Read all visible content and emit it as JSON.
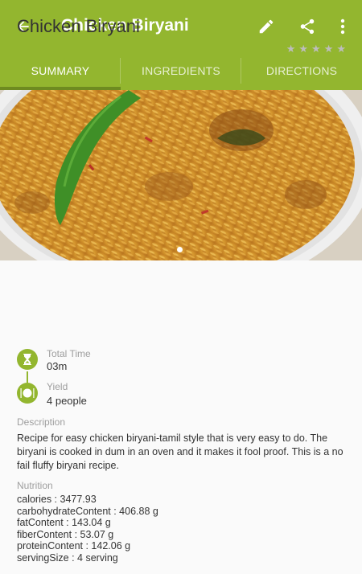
{
  "toolbar": {
    "title": "Chicken Biryani",
    "back_icon": "arrow-back-icon",
    "edit_icon": "pencil-icon",
    "share_icon": "share-icon",
    "more_icon": "more-vert-icon"
  },
  "tabs": [
    {
      "label": "SUMMARY",
      "active": true
    },
    {
      "label": "INGREDIENTS",
      "active": false
    },
    {
      "label": "DIRECTIONS",
      "active": false
    }
  ],
  "recipe": {
    "name": "Chicken Biryani",
    "rating_stars": 5,
    "rating_value": 0,
    "total_time_label": "Total Time",
    "total_time_value": "03m",
    "yield_label": "Yield",
    "yield_value": "4 people",
    "description_label": "Description",
    "description": "Recipe for easy chicken biryani-tamil style that is very easy to do. The biryani is cooked in dum in an oven and it makes it fool proof. This is a no fail fluffy biryani recipe.",
    "nutrition_label": "Nutrition",
    "nutrition": [
      "calories : 3477.93",
      "carbohydrateContent : 406.88 g",
      "fatContent : 143.04 g",
      "fiberContent : 53.07 g",
      "proteinContent : 142.06 g",
      "servingSize : 4 serving"
    ]
  },
  "colors": {
    "primary": "#93b62f",
    "tab_indicator": "#6e8b20"
  }
}
